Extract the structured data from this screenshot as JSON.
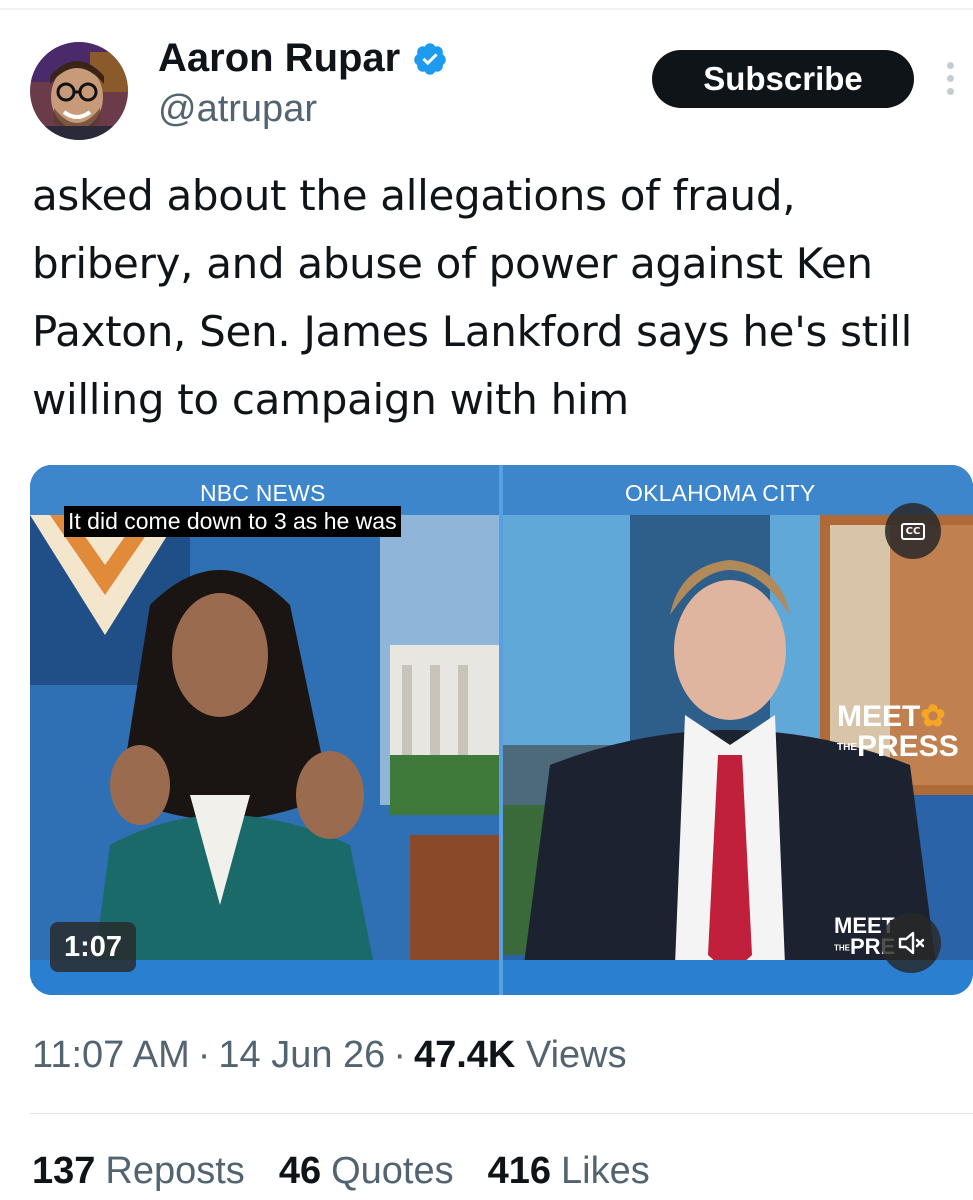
{
  "author": {
    "display_name": "Aaron Rupar",
    "handle": "@atrupar",
    "verified": true
  },
  "header": {
    "subscribe_label": "Subscribe"
  },
  "tweet": {
    "text": "asked about the allegations of fraud, bribery, and abuse of power against Ken Paxton, Sen. James Lankford says he's still willing to campaign with him"
  },
  "video": {
    "label_left": "NBC NEWS",
    "label_right": "OKLAHOMA CITY",
    "caption": "It did come down to 3 as he was",
    "cc_label": "CC",
    "logo_meet": "MEET",
    "logo_the": "THE",
    "logo_press": "PRESS",
    "logo_small_meet": "MEET",
    "logo_small_the": "THE",
    "logo_small_press": "PRE",
    "duration": "1:07"
  },
  "meta": {
    "time": "11:07 AM",
    "date": "14 Jun 26",
    "views_count": "47.4K",
    "views_label": "Views"
  },
  "stats": {
    "reposts_count": "137",
    "reposts_label": "Reposts",
    "quotes_count": "46",
    "quotes_label": "Quotes",
    "likes_count": "416",
    "likes_label": "Likes"
  },
  "colors": {
    "text_primary": "#0f1419",
    "text_secondary": "#536471",
    "verified_blue": "#1d9bf0"
  }
}
